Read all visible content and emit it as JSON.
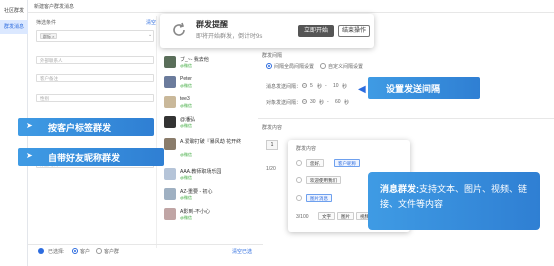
{
  "sidebar": {
    "items": [
      {
        "label": "社区群发"
      },
      {
        "label": "群发消息"
      }
    ]
  },
  "page": {
    "title": "新建客户群发消息"
  },
  "filter": {
    "heading": "筛选条件",
    "clear_link": "清空",
    "tag_label": "标签",
    "tag_chip": "群标",
    "ph_1": "外部联系人",
    "ph_2": "客户备注",
    "ph_3": "性别",
    "ph_4": "添加时间"
  },
  "contacts": [
    {
      "name": "ブ_~- 我去他",
      "sub": "@微信"
    },
    {
      "name": "Peter",
      "sub": "@微信"
    },
    {
      "name": "tee3",
      "sub": "@微信"
    },
    {
      "name": "@潘弘",
      "sub": "@微信"
    },
    {
      "name": "A.爱聊打破『暴风劫 花开终",
      "sub": "@微信"
    },
    {
      "name": "AAA.教师职场乐园",
      "sub": "@微信"
    },
    {
      "name": "AZ-重要 - 初心",
      "sub": "@微信"
    },
    {
      "name": "A影到-不小心",
      "sub": "@微信"
    }
  ],
  "bottom_bar": {
    "selected_label": "已选择:",
    "opt1": "客户",
    "opt2": "客户群",
    "clear": "清空已选"
  },
  "toast": {
    "title": "群发提醒",
    "subtitle": "即将开始群发，倒计时9s",
    "start": "立即开始",
    "cancel": "结束操作"
  },
  "interval": {
    "section": "群发间隔",
    "radio1": "间隔全局间隔设置",
    "radio2": "自定义间隔设置",
    "row1_label": "消息发送间隔：",
    "row1_from": "5",
    "row1_to": "10",
    "row2_label": "对象发送间隔：",
    "row2_from": "30",
    "row2_to": "60",
    "unit": "秒",
    "dash": "-"
  },
  "content": {
    "section": "群发内容",
    "counter": "1/20",
    "inner_title": "群发内容",
    "chip1": "您好,",
    "chip1b": "客户昵称",
    "chip2": "欢迎使用我们",
    "chip3": "图片消息",
    "counter2": "3/100",
    "tools": [
      "文字",
      "图片",
      "视频"
    ]
  },
  "callouts": {
    "c1": "按客户标签群发",
    "c2": "自带好友昵称群发",
    "c3": "设置发送间隔",
    "c4_bold": "消息群发:",
    "c4_text": "支持文本、图片、视频、链接、文件等内容"
  },
  "colors": {
    "accent": "#2d6cdf",
    "callout": "#3a8fde"
  }
}
